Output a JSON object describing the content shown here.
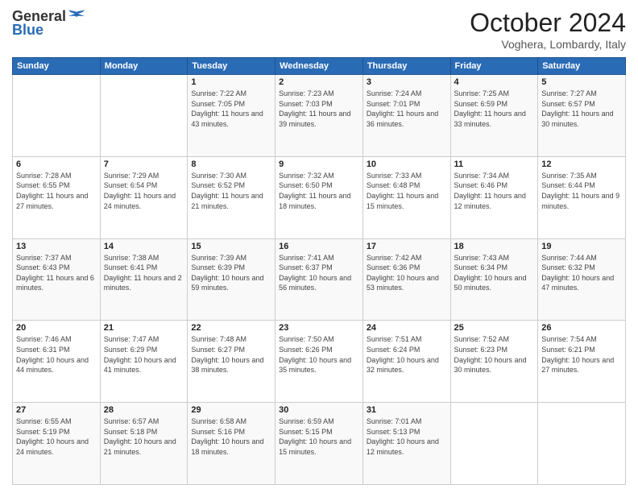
{
  "logo": {
    "line1": "General",
    "line2": "Blue"
  },
  "title": "October 2024",
  "location": "Voghera, Lombardy, Italy",
  "headers": [
    "Sunday",
    "Monday",
    "Tuesday",
    "Wednesday",
    "Thursday",
    "Friday",
    "Saturday"
  ],
  "weeks": [
    [
      {
        "day": "",
        "sunrise": "",
        "sunset": "",
        "daylight": ""
      },
      {
        "day": "",
        "sunrise": "",
        "sunset": "",
        "daylight": ""
      },
      {
        "day": "1",
        "sunrise": "Sunrise: 7:22 AM",
        "sunset": "Sunset: 7:05 PM",
        "daylight": "Daylight: 11 hours and 43 minutes."
      },
      {
        "day": "2",
        "sunrise": "Sunrise: 7:23 AM",
        "sunset": "Sunset: 7:03 PM",
        "daylight": "Daylight: 11 hours and 39 minutes."
      },
      {
        "day": "3",
        "sunrise": "Sunrise: 7:24 AM",
        "sunset": "Sunset: 7:01 PM",
        "daylight": "Daylight: 11 hours and 36 minutes."
      },
      {
        "day": "4",
        "sunrise": "Sunrise: 7:25 AM",
        "sunset": "Sunset: 6:59 PM",
        "daylight": "Daylight: 11 hours and 33 minutes."
      },
      {
        "day": "5",
        "sunrise": "Sunrise: 7:27 AM",
        "sunset": "Sunset: 6:57 PM",
        "daylight": "Daylight: 11 hours and 30 minutes."
      }
    ],
    [
      {
        "day": "6",
        "sunrise": "Sunrise: 7:28 AM",
        "sunset": "Sunset: 6:55 PM",
        "daylight": "Daylight: 11 hours and 27 minutes."
      },
      {
        "day": "7",
        "sunrise": "Sunrise: 7:29 AM",
        "sunset": "Sunset: 6:54 PM",
        "daylight": "Daylight: 11 hours and 24 minutes."
      },
      {
        "day": "8",
        "sunrise": "Sunrise: 7:30 AM",
        "sunset": "Sunset: 6:52 PM",
        "daylight": "Daylight: 11 hours and 21 minutes."
      },
      {
        "day": "9",
        "sunrise": "Sunrise: 7:32 AM",
        "sunset": "Sunset: 6:50 PM",
        "daylight": "Daylight: 11 hours and 18 minutes."
      },
      {
        "day": "10",
        "sunrise": "Sunrise: 7:33 AM",
        "sunset": "Sunset: 6:48 PM",
        "daylight": "Daylight: 11 hours and 15 minutes."
      },
      {
        "day": "11",
        "sunrise": "Sunrise: 7:34 AM",
        "sunset": "Sunset: 6:46 PM",
        "daylight": "Daylight: 11 hours and 12 minutes."
      },
      {
        "day": "12",
        "sunrise": "Sunrise: 7:35 AM",
        "sunset": "Sunset: 6:44 PM",
        "daylight": "Daylight: 11 hours and 9 minutes."
      }
    ],
    [
      {
        "day": "13",
        "sunrise": "Sunrise: 7:37 AM",
        "sunset": "Sunset: 6:43 PM",
        "daylight": "Daylight: 11 hours and 6 minutes."
      },
      {
        "day": "14",
        "sunrise": "Sunrise: 7:38 AM",
        "sunset": "Sunset: 6:41 PM",
        "daylight": "Daylight: 11 hours and 2 minutes."
      },
      {
        "day": "15",
        "sunrise": "Sunrise: 7:39 AM",
        "sunset": "Sunset: 6:39 PM",
        "daylight": "Daylight: 10 hours and 59 minutes."
      },
      {
        "day": "16",
        "sunrise": "Sunrise: 7:41 AM",
        "sunset": "Sunset: 6:37 PM",
        "daylight": "Daylight: 10 hours and 56 minutes."
      },
      {
        "day": "17",
        "sunrise": "Sunrise: 7:42 AM",
        "sunset": "Sunset: 6:36 PM",
        "daylight": "Daylight: 10 hours and 53 minutes."
      },
      {
        "day": "18",
        "sunrise": "Sunrise: 7:43 AM",
        "sunset": "Sunset: 6:34 PM",
        "daylight": "Daylight: 10 hours and 50 minutes."
      },
      {
        "day": "19",
        "sunrise": "Sunrise: 7:44 AM",
        "sunset": "Sunset: 6:32 PM",
        "daylight": "Daylight: 10 hours and 47 minutes."
      }
    ],
    [
      {
        "day": "20",
        "sunrise": "Sunrise: 7:46 AM",
        "sunset": "Sunset: 6:31 PM",
        "daylight": "Daylight: 10 hours and 44 minutes."
      },
      {
        "day": "21",
        "sunrise": "Sunrise: 7:47 AM",
        "sunset": "Sunset: 6:29 PM",
        "daylight": "Daylight: 10 hours and 41 minutes."
      },
      {
        "day": "22",
        "sunrise": "Sunrise: 7:48 AM",
        "sunset": "Sunset: 6:27 PM",
        "daylight": "Daylight: 10 hours and 38 minutes."
      },
      {
        "day": "23",
        "sunrise": "Sunrise: 7:50 AM",
        "sunset": "Sunset: 6:26 PM",
        "daylight": "Daylight: 10 hours and 35 minutes."
      },
      {
        "day": "24",
        "sunrise": "Sunrise: 7:51 AM",
        "sunset": "Sunset: 6:24 PM",
        "daylight": "Daylight: 10 hours and 32 minutes."
      },
      {
        "day": "25",
        "sunrise": "Sunrise: 7:52 AM",
        "sunset": "Sunset: 6:23 PM",
        "daylight": "Daylight: 10 hours and 30 minutes."
      },
      {
        "day": "26",
        "sunrise": "Sunrise: 7:54 AM",
        "sunset": "Sunset: 6:21 PM",
        "daylight": "Daylight: 10 hours and 27 minutes."
      }
    ],
    [
      {
        "day": "27",
        "sunrise": "Sunrise: 6:55 AM",
        "sunset": "Sunset: 5:19 PM",
        "daylight": "Daylight: 10 hours and 24 minutes."
      },
      {
        "day": "28",
        "sunrise": "Sunrise: 6:57 AM",
        "sunset": "Sunset: 5:18 PM",
        "daylight": "Daylight: 10 hours and 21 minutes."
      },
      {
        "day": "29",
        "sunrise": "Sunrise: 6:58 AM",
        "sunset": "Sunset: 5:16 PM",
        "daylight": "Daylight: 10 hours and 18 minutes."
      },
      {
        "day": "30",
        "sunrise": "Sunrise: 6:59 AM",
        "sunset": "Sunset: 5:15 PM",
        "daylight": "Daylight: 10 hours and 15 minutes."
      },
      {
        "day": "31",
        "sunrise": "Sunrise: 7:01 AM",
        "sunset": "Sunset: 5:13 PM",
        "daylight": "Daylight: 10 hours and 12 minutes."
      },
      {
        "day": "",
        "sunrise": "",
        "sunset": "",
        "daylight": ""
      },
      {
        "day": "",
        "sunrise": "",
        "sunset": "",
        "daylight": ""
      }
    ]
  ]
}
